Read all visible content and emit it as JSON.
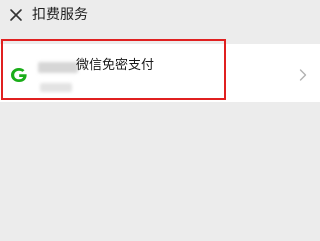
{
  "header": {
    "close_icon": "close-icon",
    "title": "扣费服务"
  },
  "service_item": {
    "name": "微信免密支付",
    "icon": "brand-g-icon",
    "chevron_icon": "chevron-right-icon",
    "highlight_color": "#e02020",
    "brand_color": "#1aad19"
  }
}
